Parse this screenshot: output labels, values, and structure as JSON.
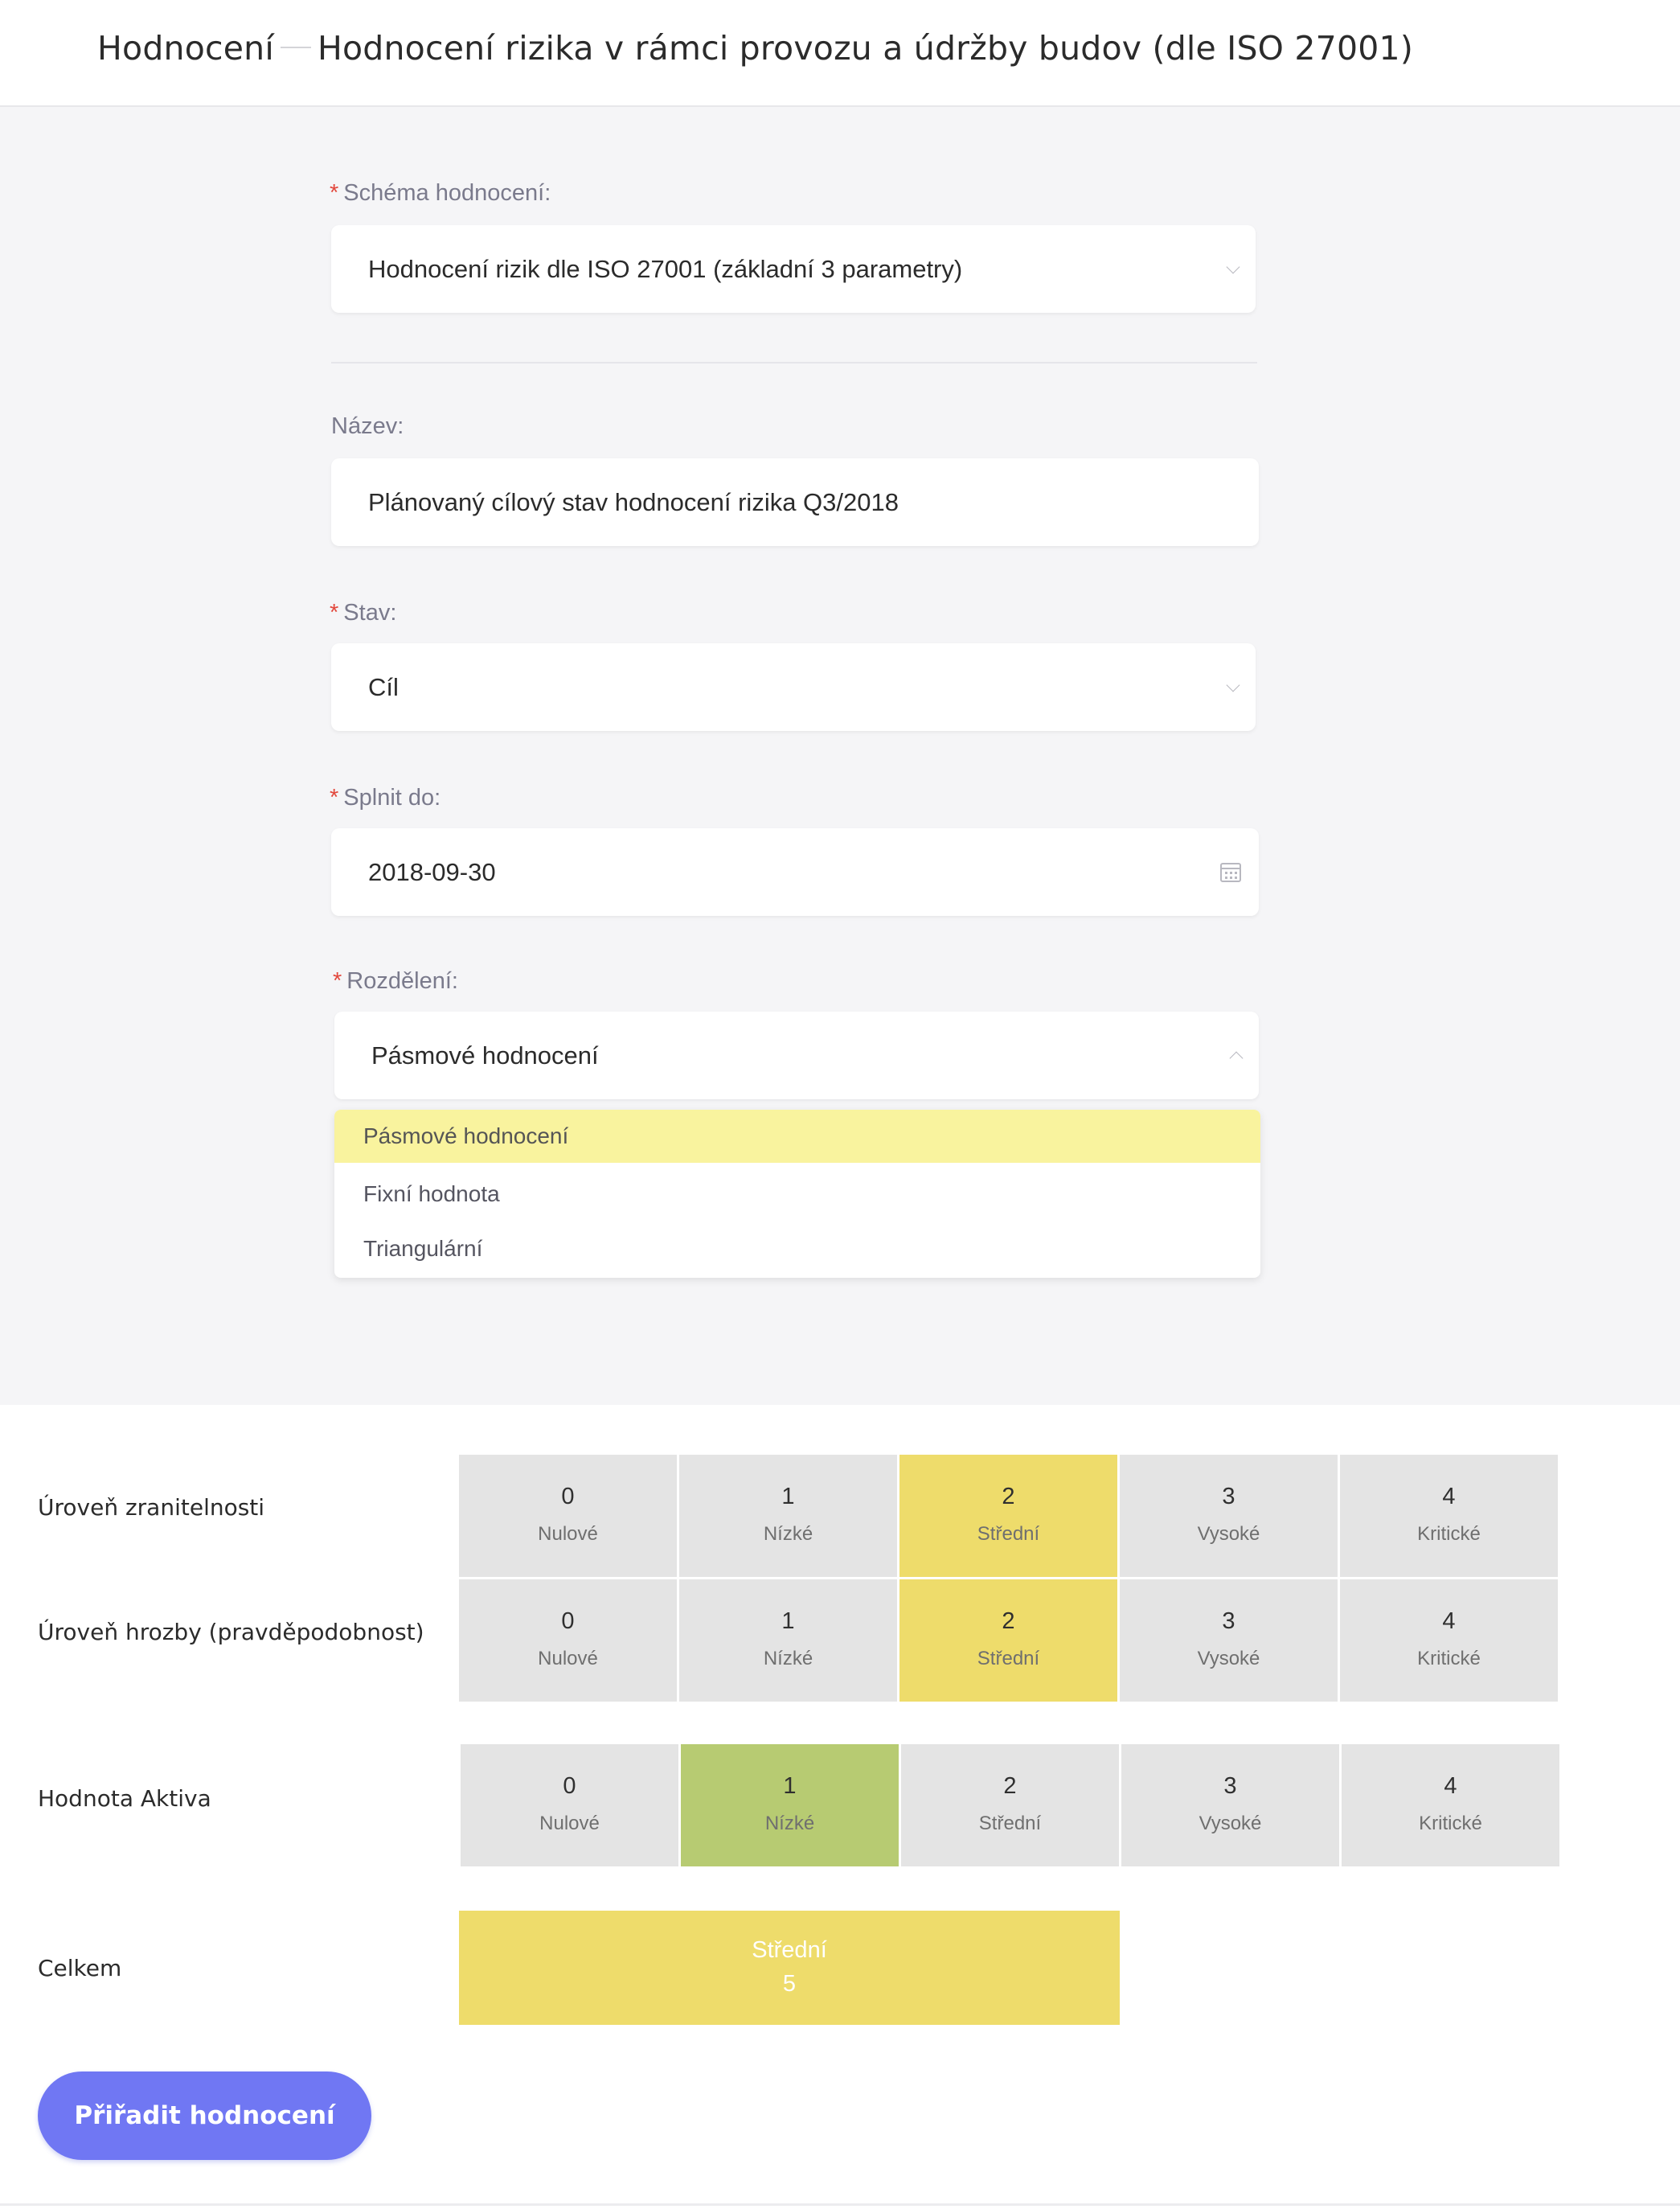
{
  "header": {
    "section": "Hodnocení",
    "title": "Hodnocení rizika v rámci provozu a údržby budov (dle ISO 27001)"
  },
  "form": {
    "required_mark": "*",
    "schema": {
      "label": "Schéma hodnocení:",
      "value": "Hodnocení rizik dle ISO 27001 (základní 3 parametry)",
      "icon": "chevron-down-icon"
    },
    "name": {
      "label": "Název:",
      "value": "Plánovaný cílový stav hodnocení rizika Q3/2018"
    },
    "state": {
      "label": "Stav:",
      "value": "Cíl",
      "icon": "chevron-down-icon"
    },
    "due": {
      "label": "Splnit do:",
      "value": "2018-09-30",
      "icon": "calendar-icon"
    },
    "distribution": {
      "label": "Rozdělení:",
      "value": "Pásmové hodnocení",
      "icon": "chevron-up-icon",
      "options": [
        "Pásmové hodnocení",
        "Fixní hodnota",
        "Triangulární"
      ],
      "highlighted_option": "Pásmové hodnocení"
    }
  },
  "ratings": {
    "rows": [
      {
        "label": "Úroveň zranitelnosti",
        "selected": 2,
        "selected_color": "#eedc6b",
        "cells": [
          {
            "num": "0",
            "level": "Nulové"
          },
          {
            "num": "1",
            "level": "Nízké"
          },
          {
            "num": "2",
            "level": "Střední"
          },
          {
            "num": "3",
            "level": "Vysoké"
          },
          {
            "num": "4",
            "level": "Kritické"
          }
        ]
      },
      {
        "label": "Úroveň hrozby (pravděpodobnost)",
        "selected": 2,
        "selected_color": "#eedc6b",
        "cells": [
          {
            "num": "0",
            "level": "Nulové"
          },
          {
            "num": "1",
            "level": "Nízké"
          },
          {
            "num": "2",
            "level": "Střední"
          },
          {
            "num": "3",
            "level": "Vysoké"
          },
          {
            "num": "4",
            "level": "Kritické"
          }
        ]
      },
      {
        "label": "Hodnota Aktiva",
        "selected": 1,
        "selected_color": "#b7cb72",
        "cells": [
          {
            "num": "0",
            "level": "Nulové"
          },
          {
            "num": "1",
            "level": "Nízké"
          },
          {
            "num": "2",
            "level": "Střední"
          },
          {
            "num": "3",
            "level": "Vysoké"
          },
          {
            "num": "4",
            "level": "Kritické"
          }
        ]
      }
    ],
    "total": {
      "label": "Celkem",
      "level": "Střední",
      "value": "5",
      "color": "#eedc6b"
    }
  },
  "actions": {
    "assign_label": "Přiřadit hodnocení",
    "accent": "#7077f3"
  }
}
